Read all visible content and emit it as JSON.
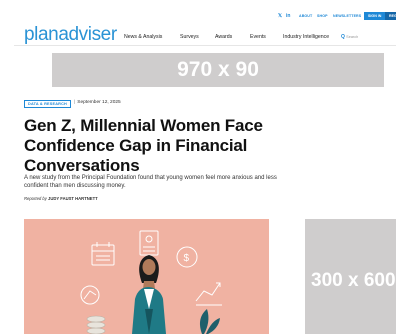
{
  "utility": {
    "social_x": "𝕏",
    "social_in": "in",
    "about": "ABOUT",
    "shop": "SHOP",
    "newsletters": "NEWSLETTERS",
    "signin": "SIGN IN",
    "more": "REGI"
  },
  "header": {
    "logo": "planadviser",
    "nav": [
      "News & Analysis",
      "Surveys",
      "Awards",
      "Events",
      "Industry Intelligence"
    ],
    "search_icon": "search-icon",
    "search_placeholder": "Search"
  },
  "ads": {
    "banner": "970 x 90",
    "side": "300 x 600"
  },
  "article": {
    "tag": "DATA & RESEARCH",
    "date": "September 12, 2025",
    "headline": "Gen Z, Millennial Women Face Confidence Gap in Financial Conversations",
    "dek": "A new study from the Principal Foundation found that young women feel more anxious and less confident than men discussing money.",
    "byline_prefix": "Reported by",
    "byline_author": "JUDY FAUST HARTNETT"
  },
  "colors": {
    "brand": "#2a93d5",
    "hero_bg": "#f0b2a2",
    "ad_placeholder": "#cfcdcd"
  }
}
